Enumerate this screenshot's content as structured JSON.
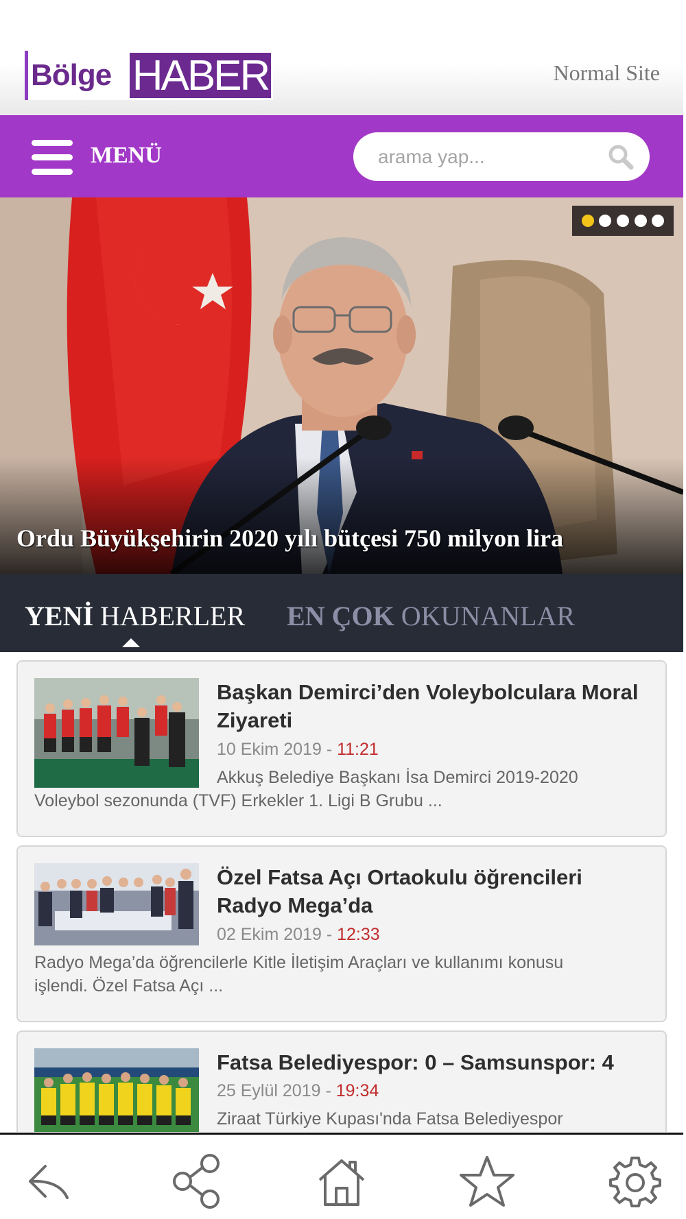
{
  "header": {
    "logo_part1": "Bölge",
    "logo_part2": "HABER",
    "normal_site_link": "Normal Site"
  },
  "menubar": {
    "menu_label": "MENÜ",
    "search_placeholder": "arama yap...",
    "color": "#a238c7"
  },
  "hero": {
    "title": "Ordu Büyükşehirin 2020 yılı bütçesi 750 milyon lira",
    "slide_count": 5,
    "active_slide": 1,
    "active_dot_color": "#f3c51a"
  },
  "tabs": {
    "new_bold": "YENİ",
    "new_rest": " HABERLER",
    "most_bold": "EN ÇOK",
    "most_rest": " OKUNANLAR",
    "active": "YENİ HABERLER"
  },
  "news": [
    {
      "title": "Başkan Demirci’den Voleybolculara Moral Ziyareti",
      "date": "10 Ekim 2019",
      "separator": " - ",
      "time": "11:21",
      "summary_line1": "Akkuş Belediye Başkanı İsa Demirci 2019-2020",
      "summary_line2": "Voleybol sezonunda (TVF) Erkekler 1. Ligi B Grubu ..."
    },
    {
      "title": "Özel Fatsa Açı Ortaokulu öğrencileri Radyo Mega’da",
      "date": "02 Ekim 2019",
      "separator": " - ",
      "time": "12:33",
      "summary_line1": "Radyo Mega’da öğrencilerle Kitle İletişim Araçları ve kullanımı konusu",
      "summary_line2": "işlendi. Özel Fatsa Açı ..."
    },
    {
      "title": "Fatsa Belediyespor: 0 – Samsunspor: 4",
      "date": "25 Eylül 2019",
      "separator": " - ",
      "time": "19:34",
      "summary_line1": "Ziraat Türkiye Kupası'nda Fatsa Belediyespor",
      "summary_line2": ""
    }
  ],
  "bottombar": {
    "icons": [
      "back-icon",
      "share-icon",
      "home-icon",
      "star-icon",
      "settings-icon"
    ]
  }
}
